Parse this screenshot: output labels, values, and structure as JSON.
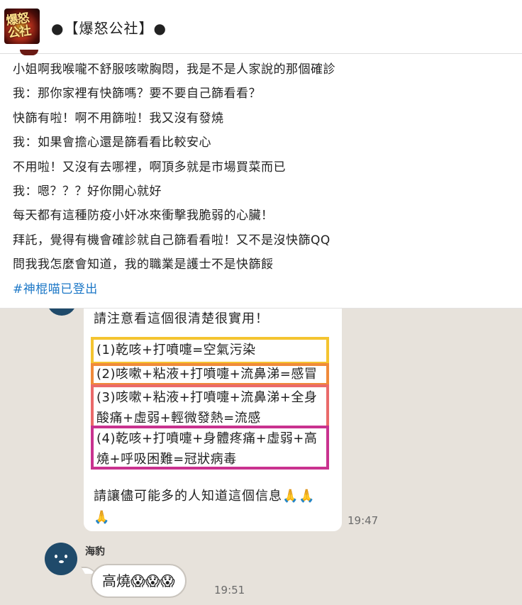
{
  "header": {
    "group_name": "●【爆怒公社】●",
    "avatar_text": "爆怒公社"
  },
  "post": {
    "lines": [
      "小姐啊我喉嚨不舒服咳嗽胸悶，我是不是人家說的那個確診",
      "我：那你家裡有快篩嗎？要不要自己篩看看？",
      "快篩有啦！啊不用篩啦！我又沒有發燒",
      "我：如果會擔心還是篩看看比較安心",
      "不用啦！又沒有去哪裡，啊頂多就是市場買菜而已",
      "我：嗯？？？好你開心就好",
      "每天都有這種防疫小奸冰來衝擊我脆弱的心臟！",
      "拜託，覺得有機會確診就自己篩看看啦！又不是沒快篩QQ",
      "問我我怎麼會知道，我的職業是護士不是快篩餒"
    ],
    "hashtag": "#神棍喵已登出"
  },
  "chat": {
    "image_message": {
      "intro": "請注意看這個很清楚很實用！",
      "symptoms": [
        "(1)乾咳+打噴嚏=空氣污染",
        "(2)咳嗽+粘液+打噴嚏+流鼻涕=感冒",
        "(3)咳嗽+粘液+打噴嚏+流鼻涕+全身酸痛+虛弱+輕微發熱=流感",
        "(4)乾咳+打噴嚏+身體疼痛+虛弱+高燒+呼吸困難=冠狀病毒"
      ],
      "outro": "請讓儘可能多的人知道這個信息🙏🙏🙏",
      "time": "19:47"
    },
    "reply": {
      "sender": "海豹",
      "text": "高燒😱😱😱",
      "time": "19:51"
    }
  },
  "colors": {
    "box1": "#f4c430",
    "box2": "#f08a3a",
    "box3": "#ea6a6a",
    "box4": "#c9328f",
    "hashtag": "#1d78c7",
    "chat_bg": "#e7e2db"
  }
}
